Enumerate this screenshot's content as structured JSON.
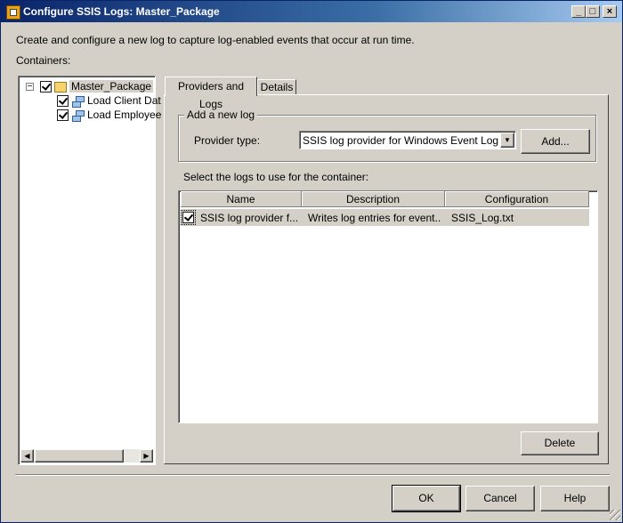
{
  "window": {
    "title": "Configure SSIS Logs: Master_Package"
  },
  "intro": "Create and configure a new log to capture log-enabled events that occur at run time.",
  "containers_label": "Containers:",
  "tree": {
    "root": "Master_Package",
    "children": [
      "Load Client Dat",
      "Load Employee"
    ]
  },
  "tabs": [
    "Providers and Logs",
    "Details"
  ],
  "add_log": {
    "group_title": "Add a new log",
    "provider_label": "Provider type:",
    "provider_value": "SSIS log provider for Windows Event Log",
    "add_button": "Add..."
  },
  "logs": {
    "label": "Select the logs to use for the container:",
    "columns": [
      "Name",
      "Description",
      "Configuration"
    ],
    "rows": [
      {
        "checked": true,
        "name": "SSIS log provider f...",
        "description": "Writes log entries for event...",
        "configuration": "SSIS_Log.txt"
      }
    ],
    "delete_button": "Delete"
  },
  "footer": {
    "ok": "OK",
    "cancel": "Cancel",
    "help": "Help"
  }
}
